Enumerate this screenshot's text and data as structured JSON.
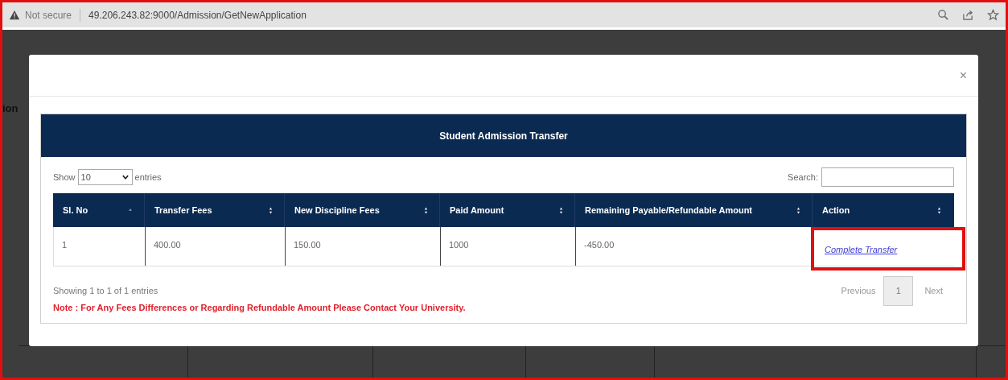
{
  "address_bar": {
    "security_label": "Not secure",
    "url": "49.206.243.82:9000/Admission/GetNewApplication"
  },
  "background_page": {
    "cut_text": "ion"
  },
  "modal": {
    "close": "×",
    "panel": {
      "title": "Student Admission Transfer",
      "length": {
        "show_label": "Show",
        "value": "10",
        "entries_label": "entries"
      },
      "search": {
        "label": "Search:"
      },
      "table": {
        "columns": [
          {
            "label": "Sl. No",
            "kind": "sorted"
          },
          {
            "label": "Transfer Fees",
            "kind": "sortable"
          },
          {
            "label": "New Discipline Fees",
            "kind": "sortable"
          },
          {
            "label": "Paid Amount",
            "kind": "sortable"
          },
          {
            "label": "Remaining Payable/Refundable Amount",
            "kind": "sortable"
          },
          {
            "label": "Action",
            "kind": "sortable"
          }
        ],
        "rows": [
          {
            "cells": [
              "1",
              "400.00",
              "150.00",
              "1000",
              "-450.00"
            ],
            "action": "Complete Transfer",
            "highlighted": true
          }
        ]
      },
      "info": "Showing 1 to 1 of 1 entries",
      "pagination": {
        "previous": "Previous",
        "pages": [
          {
            "label": "1",
            "selected": true
          }
        ],
        "next": "Next"
      },
      "note": "Note : For Any Fees Differences or Regarding Refundable Amount Please Contact Your University."
    }
  }
}
